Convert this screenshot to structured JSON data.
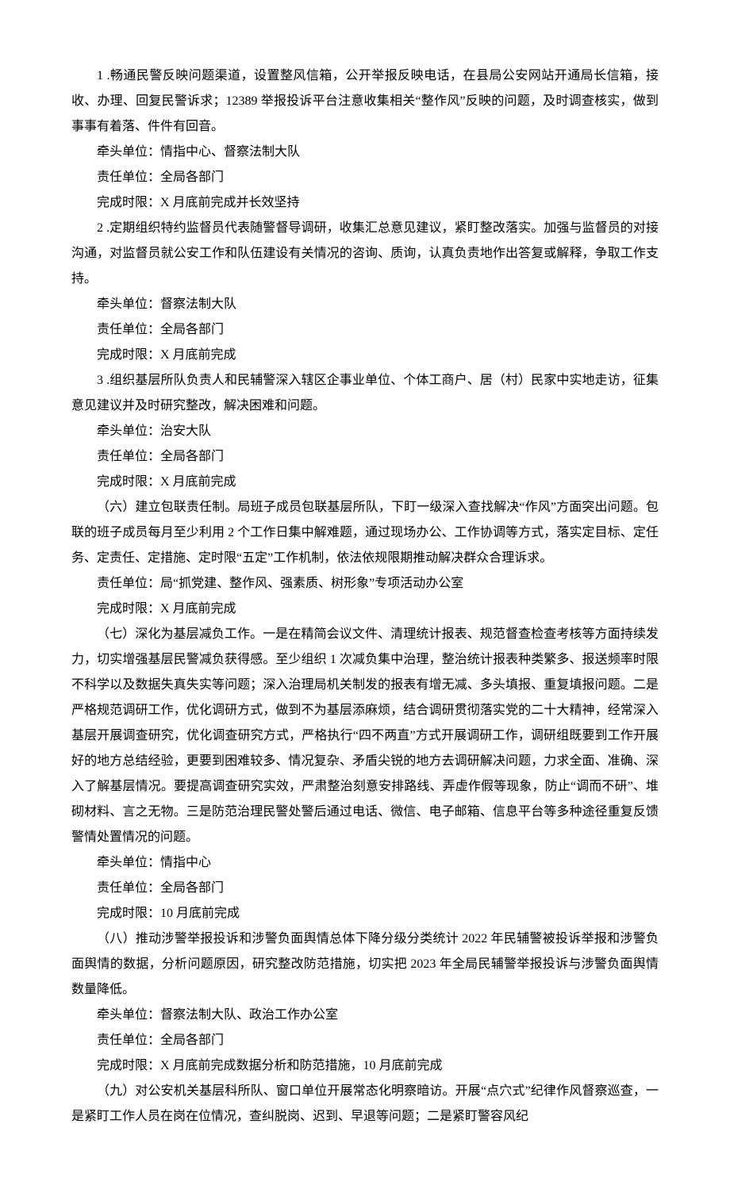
{
  "paragraphs": [
    {
      "type": "para",
      "text": "1 .畅通民警反映问题渠道，设置整风信箱，公开举报反映电话，在县局公安网站开通局长信箱，接收、办理、回复民警诉求；12389 举报投诉平台注意收集相关“整作风”反映的问题，及时调查核实，做到事事有着落、件件有回音。"
    },
    {
      "type": "detail",
      "text": "牵头单位：情指中心、督察法制大队"
    },
    {
      "type": "detail",
      "text": "责任单位：全局各部门"
    },
    {
      "type": "detail",
      "text": "完成时限：X 月底前完成并长效坚持"
    },
    {
      "type": "para",
      "text": "2 .定期组织特约监督员代表随警督导调研，收集汇总意见建议，紧盯整改落实。加强与监督员的对接沟通，对监督员就公安工作和队伍建设有关情况的咨询、质询，认真负责地作出答复或解释，争取工作支持。"
    },
    {
      "type": "detail",
      "text": "牵头单位：督察法制大队"
    },
    {
      "type": "detail",
      "text": "责任单位：全局各部门"
    },
    {
      "type": "detail",
      "text": "完成时限：X 月底前完成"
    },
    {
      "type": "para",
      "text": "3 .组织基层所队负责人和民辅警深入辖区企事业单位、个体工商户、居（村）民家中实地走访，征集意见建议并及时研究整改，解决困难和问题。"
    },
    {
      "type": "detail",
      "text": "牵头单位：治安大队"
    },
    {
      "type": "detail",
      "text": "责任单位：全局各部门"
    },
    {
      "type": "detail",
      "text": "完成时限：X 月底前完成"
    },
    {
      "type": "para",
      "text": "（六）建立包联责任制。局班子成员包联基层所队，下盯一级深入查找解决“作风”方面突出问题。包联的班子成员每月至少利用 2 个工作日集中解难题，通过现场办公、工作协调等方式，落实定目标、定任务、定责任、定措施、定时限“五定”工作机制，依法依规限期推动解决群众合理诉求。"
    },
    {
      "type": "detail",
      "text": "责任单位：局“抓党建、整作风、强素质、树形象”专项活动办公室"
    },
    {
      "type": "detail",
      "text": "完成时限：X 月底前完成"
    },
    {
      "type": "para",
      "text": "（七）深化为基层减负工作。一是在精简会议文件、清理统计报表、规范督查检查考核等方面持续发力，切实增强基层民警减负获得感。至少组织 1 次减负集中治理，整治统计报表种类繁多、报送频率时限不科学以及数据失真失实等问题；深入治理局机关制发的报表有增无减、多头填报、重复填报问题。二是严格规范调研工作，优化调研方式，做到不为基层添麻烦，结合调研贯彻落实党的二十大精神，经常深入基层开展调查研究，优化调查研究方式，严格执行“四不两直”方式开展调研工作，调研组既要到工作开展好的地方总结经验，更要到困难较多、情况复杂、矛盾尖锐的地方去调研解决问题，力求全面、准确、深入了解基层情况。要提高调查研究实效，严肃整治刻意安排路线、弄虚作假等现象，防止“调而不研”、堆砌材料、言之无物。三是防范治理民警处警后通过电话、微信、电子邮箱、信息平台等多种途径重复反馈警情处置情况的问题。"
    },
    {
      "type": "detail",
      "text": "牵头单位：情指中心"
    },
    {
      "type": "detail",
      "text": "责任单位：全局各部门"
    },
    {
      "type": "detail",
      "text": "完成时限：10 月底前完成"
    },
    {
      "type": "para",
      "text": "（八）推动涉警举报投诉和涉警负面舆情总体下降分级分类统计 2022 年民辅警被投诉举报和涉警负面舆情的数据，分析问题原因，研究整改防范措施，切实把 2023 年全局民辅警举报投诉与涉警负面舆情数量降低。"
    },
    {
      "type": "detail",
      "text": "牵头单位：督察法制大队、政治工作办公室"
    },
    {
      "type": "detail",
      "text": "责任单位：全局各部门"
    },
    {
      "type": "detail",
      "text": "完成时限：X 月底前完成数据分析和防范措施，10 月底前完成"
    },
    {
      "type": "para",
      "text": "（九）对公安机关基层科所队、窗口单位开展常态化明察暗访。开展“点穴式”纪律作风督察巡查，一是紧盯工作人员在岗在位情况，查纠脱岗、迟到、早退等问题；二是紧盯警容风纪"
    }
  ]
}
